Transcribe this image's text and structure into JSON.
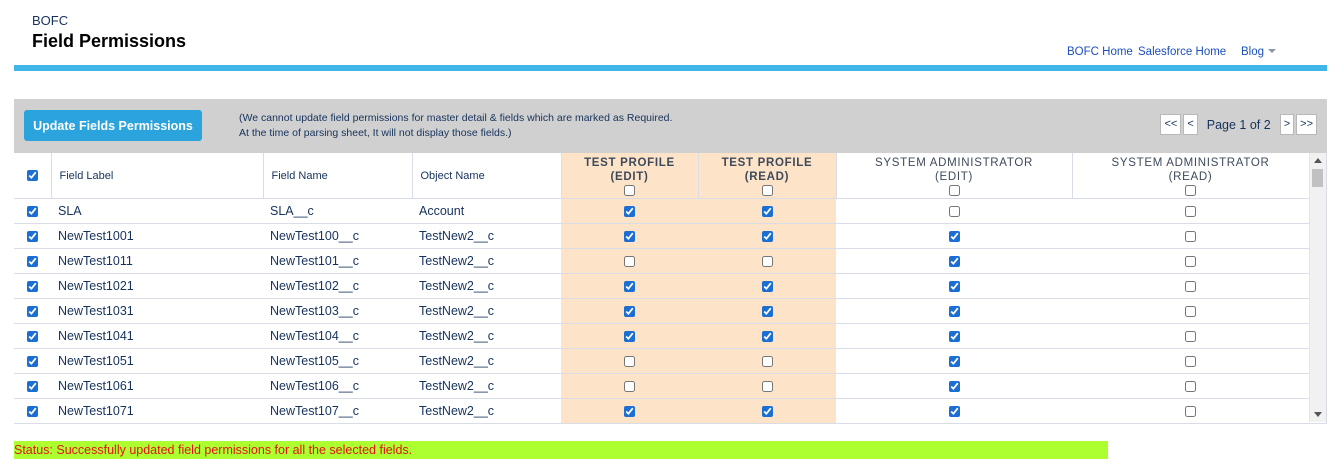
{
  "header": {
    "app_name": "BOFC",
    "title": "Field Permissions",
    "links": [
      "BOFC Home",
      "Salesforce Home"
    ],
    "blog_label": "Blog"
  },
  "toolbar": {
    "update_label": "Update Fields Permissions",
    "note_line1": "(We cannot update field permissions for master detail & fields which are marked as Required.",
    "note_line2": "At the time of parsing sheet, It will not display those fields.)",
    "pager": {
      "first": "<<",
      "prev": "<",
      "page_text": "Page 1 of 2",
      "next": ">",
      "last": ">>"
    }
  },
  "table": {
    "select_all_checked": true,
    "columns": {
      "field_label": "Field Label",
      "field_name": "Field Name",
      "object_name": "Object Name"
    },
    "profiles": [
      {
        "name": "TEST PROFILE",
        "mode": "(EDIT)",
        "header_checked": false,
        "highlight": true
      },
      {
        "name": "TEST PROFILE",
        "mode": "(READ)",
        "header_checked": false,
        "highlight": true
      },
      {
        "name": "SYSTEM ADMINISTRATOR",
        "mode": "(EDIT)",
        "header_checked": false,
        "highlight": false
      },
      {
        "name": "SYSTEM ADMINISTRATOR",
        "mode": "(READ)",
        "header_checked": false,
        "highlight": false
      }
    ],
    "rows": [
      {
        "selected": true,
        "label": "SLA",
        "name": "SLA__c",
        "object": "Account",
        "perms": [
          true,
          true,
          false,
          false
        ]
      },
      {
        "selected": true,
        "label": "NewTest1001",
        "name": "NewTest100__c",
        "object": "TestNew2__c",
        "perms": [
          true,
          true,
          true,
          false
        ]
      },
      {
        "selected": true,
        "label": "NewTest1011",
        "name": "NewTest101__c",
        "object": "TestNew2__c",
        "perms": [
          false,
          false,
          true,
          false
        ]
      },
      {
        "selected": true,
        "label": "NewTest1021",
        "name": "NewTest102__c",
        "object": "TestNew2__c",
        "perms": [
          true,
          true,
          true,
          false
        ]
      },
      {
        "selected": true,
        "label": "NewTest1031",
        "name": "NewTest103__c",
        "object": "TestNew2__c",
        "perms": [
          true,
          true,
          true,
          false
        ]
      },
      {
        "selected": true,
        "label": "NewTest1041",
        "name": "NewTest104__c",
        "object": "TestNew2__c",
        "perms": [
          true,
          true,
          true,
          false
        ]
      },
      {
        "selected": true,
        "label": "NewTest1051",
        "name": "NewTest105__c",
        "object": "TestNew2__c",
        "perms": [
          false,
          false,
          true,
          false
        ]
      },
      {
        "selected": true,
        "label": "NewTest1061",
        "name": "NewTest106__c",
        "object": "TestNew2__c",
        "perms": [
          false,
          false,
          true,
          false
        ]
      },
      {
        "selected": true,
        "label": "NewTest1071",
        "name": "NewTest107__c",
        "object": "TestNew2__c",
        "perms": [
          true,
          true,
          true,
          false
        ]
      }
    ]
  },
  "status": {
    "text": "Status: Successfully updated field permissions for all the selected fields."
  },
  "colors": {
    "accent_bar": "#3fb5e8",
    "button": "#2ba3dd",
    "profile_highlight": "#fde4c8",
    "status_bg": "#adff2f",
    "status_text": "#e0141e"
  }
}
